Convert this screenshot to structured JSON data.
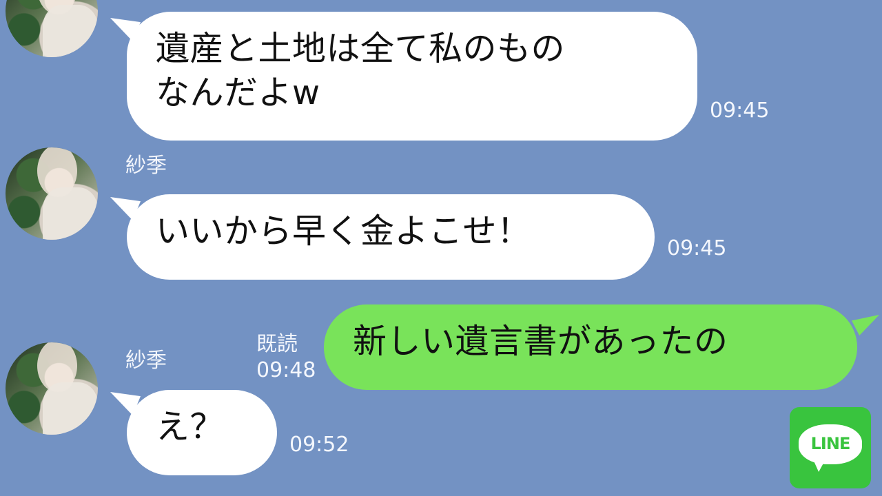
{
  "messages": [
    {
      "type": "incoming",
      "text": "遺産と土地は全て私のもの\nなんだよw",
      "time": "09:45"
    },
    {
      "type": "incoming",
      "sender": "紗季",
      "text": "いいから早く金よこせ！",
      "time": "09:45"
    },
    {
      "type": "outgoing",
      "status": "既読",
      "text": "新しい遺言書があったの",
      "time": "09:48"
    },
    {
      "type": "incoming",
      "sender": "紗季",
      "text": "え？",
      "time": "09:52"
    }
  ],
  "branding": {
    "logo_text": "LINE",
    "logo_color": "#39c43e"
  },
  "icons": {
    "avatar": "profile-photo-avatar",
    "logo": "line-logo-icon"
  },
  "colors": {
    "background": "#7392c3",
    "incoming_bubble": "#ffffff",
    "outgoing_bubble": "#79e35a"
  }
}
